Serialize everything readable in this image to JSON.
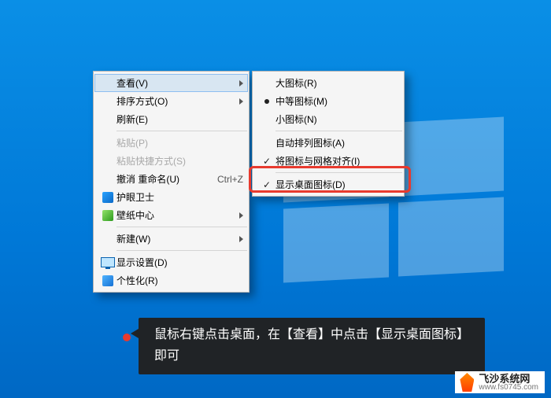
{
  "main_menu": {
    "view": {
      "label": "查看(V)"
    },
    "sort": {
      "label": "排序方式(O)"
    },
    "refresh": {
      "label": "刷新(E)"
    },
    "paste": {
      "label": "粘贴(P)"
    },
    "paste_shortcut": {
      "label": "粘贴快捷方式(S)"
    },
    "undo": {
      "label": "撤消 重命名(U)",
      "shortcut": "Ctrl+Z"
    },
    "huyan": {
      "label": "护眼卫士"
    },
    "wallpaper": {
      "label": "壁纸中心"
    },
    "new": {
      "label": "新建(W)"
    },
    "display": {
      "label": "显示设置(D)"
    },
    "personalize": {
      "label": "个性化(R)"
    }
  },
  "view_submenu": {
    "large": {
      "label": "大图标(R)"
    },
    "medium": {
      "label": "中等图标(M)"
    },
    "small": {
      "label": "小图标(N)"
    },
    "auto_arrange": {
      "label": "自动排列图标(A)"
    },
    "align_grid": {
      "label": "将图标与网格对齐(I)"
    },
    "show_icons": {
      "label": "显示桌面图标(D)"
    }
  },
  "instruction": {
    "text": "鼠标右键点击桌面，在【查看】中点击【显示桌面图标】即可"
  },
  "watermark": {
    "title": "飞沙系统网",
    "url": "www.fs0745.com"
  }
}
